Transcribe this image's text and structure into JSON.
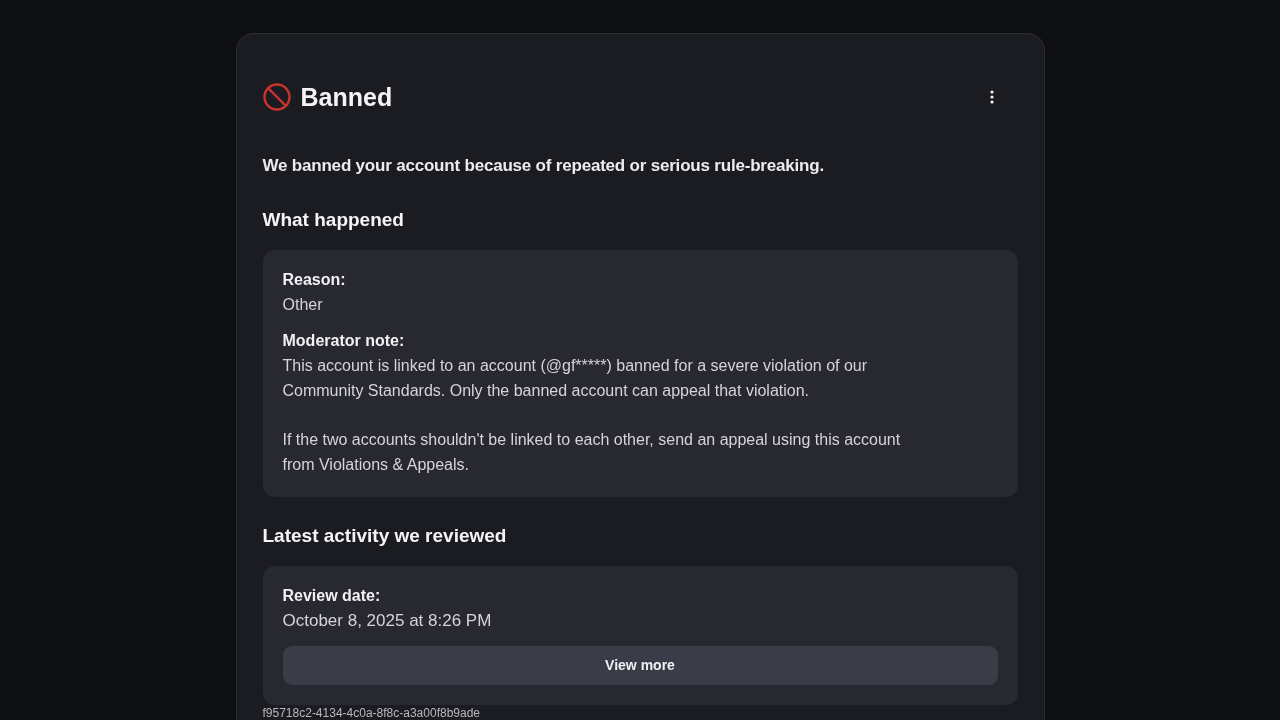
{
  "header": {
    "title": "Banned"
  },
  "description": "We banned your account because of repeated or serious rule-breaking.",
  "sections": [
    {
      "heading": "What happened",
      "fields": [
        {
          "label": "Reason:",
          "paragraphs": [
            [
              "Other"
            ]
          ]
        },
        {
          "label": "Moderator note:",
          "paragraphs": [
            [
              "This account is linked to an account (@gf*****) banned for a severe violation of our",
              "Community Standards. Only the banned account can appeal that violation."
            ],
            [
              "If the two accounts shouldn't be linked to each other, send an appeal using this account",
              "from Violations & Appeals."
            ]
          ]
        }
      ]
    },
    {
      "heading": "Latest activity we reviewed",
      "fields": [
        {
          "label": "Review date:",
          "paragraphs": [
            [
              "October 8, 2025 at 8:26 PM"
            ]
          ]
        }
      ],
      "button": "View more"
    }
  ],
  "reference_id": "f95718c2-4134-4c0a-8f8c-a3a00f8b9ade"
}
